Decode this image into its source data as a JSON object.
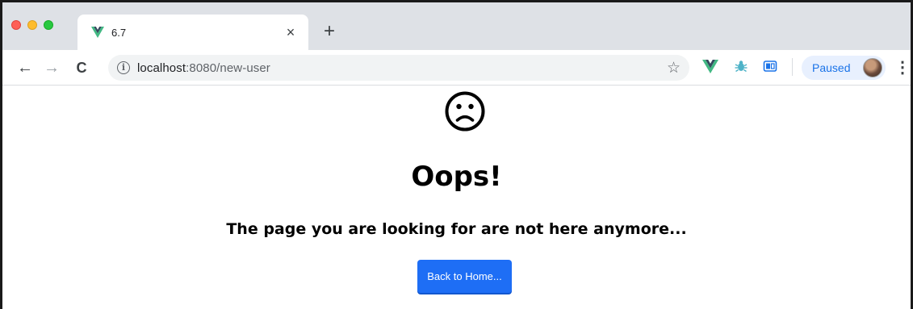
{
  "tab": {
    "title": "6.7",
    "close_glyph": "×",
    "new_tab_glyph": "+"
  },
  "toolbar": {
    "back_glyph": "←",
    "forward_glyph": "→",
    "reload_glyph": "C",
    "info_glyph": "i",
    "url_host": "localhost",
    "url_rest": ":8080/new-user",
    "star_glyph": "☆",
    "profile_label": "Paused",
    "menu_glyph": "⋮"
  },
  "page": {
    "heading": "Oops!",
    "subtitle": "The page you are looking for are not here anymore...",
    "button_label": "Back to Home..."
  },
  "colors": {
    "tabstrip": "#dee1e6",
    "omnibox": "#f1f3f4",
    "vue_green": "#42b883",
    "vue_dark": "#35495e",
    "button_blue": "#1e6ef5",
    "paused_blue": "#1a73e8"
  },
  "icons": {
    "tab_favicon": "vue-logo-icon",
    "extensions": [
      "vue-devtools-icon",
      "bug-icon",
      "box-extension-icon"
    ],
    "page_icon": "sad-face-icon"
  }
}
